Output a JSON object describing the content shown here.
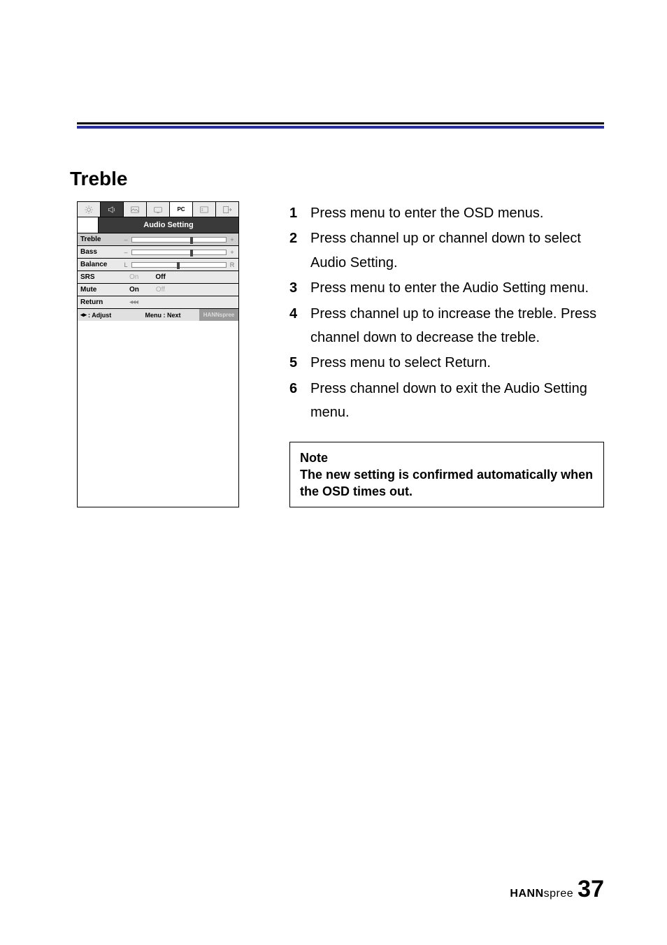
{
  "heading": "Treble",
  "osd": {
    "title": "Audio Setting",
    "pc_tab": "PC",
    "rows": {
      "treble": {
        "label": "Treble",
        "left": "–",
        "right": "+"
      },
      "bass": {
        "label": "Bass",
        "left": "–",
        "right": "+"
      },
      "balance": {
        "label": "Balance",
        "left": "L",
        "right": "R"
      },
      "srs": {
        "label": "SRS",
        "opt1": "On",
        "opt2": "Off"
      },
      "mute": {
        "label": "Mute",
        "opt1": "On",
        "opt2": "Off"
      },
      "return": {
        "label": "Return",
        "arrows": "◂◂◂"
      }
    },
    "footer": {
      "adjust_icon": "◂▸",
      "adjust": ": Adjust",
      "menu_next": "Menu : Next",
      "brand": "HANNspree"
    }
  },
  "steps": [
    "Press menu to enter the OSD menus.",
    "Press channel up or channel down to select Audio Setting.",
    "Press menu to enter the Audio Setting menu.",
    "Press channel up to increase the treble. Press channel down to decrease the treble.",
    "Press menu to select Return.",
    "Press channel down to exit the Audio Setting menu."
  ],
  "note": {
    "label": "Note",
    "text": "The new setting is confirmed automatically when the OSD times out."
  },
  "footer": {
    "brand_bold": "HANN",
    "brand_light": "spree",
    "page": "37"
  }
}
